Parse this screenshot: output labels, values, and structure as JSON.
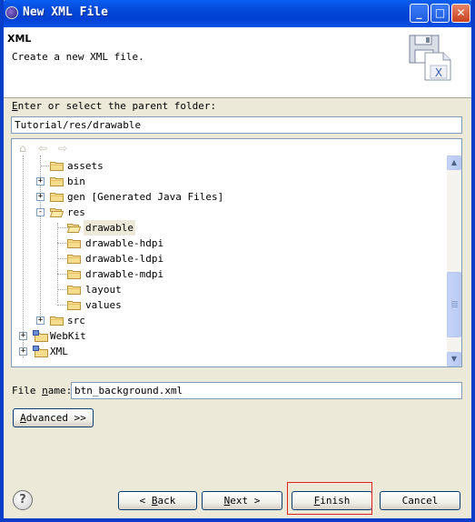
{
  "window": {
    "title": "New XML File",
    "controls": {
      "minimize": "_",
      "maximize": "□",
      "close": "✕"
    }
  },
  "banner": {
    "title": "XML",
    "description": "Create a new XML file."
  },
  "parent_folder": {
    "label_pre": "",
    "label_mnemonic": "E",
    "label_post": "nter or select the parent folder:",
    "value": "Tutorial/res/drawable"
  },
  "tree": {
    "toolbar": [
      "home-icon",
      "back-arrow-icon",
      "forward-arrow-icon"
    ],
    "items": [
      {
        "label": "assets",
        "expander": ""
      },
      {
        "label": "bin",
        "expander": "+"
      },
      {
        "label": "gen [Generated Java Files]",
        "expander": "+"
      },
      {
        "label": "res",
        "expander": "-"
      },
      {
        "label": "drawable",
        "expander": "",
        "selected": true
      },
      {
        "label": "drawable-hdpi",
        "expander": ""
      },
      {
        "label": "drawable-ldpi",
        "expander": ""
      },
      {
        "label": "drawable-mdpi",
        "expander": ""
      },
      {
        "label": "layout",
        "expander": ""
      },
      {
        "label": "values",
        "expander": ""
      },
      {
        "label": "src",
        "expander": "+"
      },
      {
        "label": "WebKit",
        "expander": "+"
      },
      {
        "label": "XML",
        "expander": "+"
      }
    ]
  },
  "file_name": {
    "label_pre": "File ",
    "label_mnemonic": "n",
    "label_post": "ame:",
    "value": "btn_background.xml"
  },
  "buttons": {
    "advanced": {
      "mnemonic": "A",
      "rest": "dvanced >>"
    },
    "back": {
      "pre": "< ",
      "mnemonic": "B",
      "rest": "ack"
    },
    "next": {
      "mnemonic": "N",
      "rest": "ext >"
    },
    "finish": {
      "mnemonic": "F",
      "rest": "inish"
    },
    "cancel": {
      "label": "Cancel"
    },
    "help": {
      "label": "?"
    }
  },
  "colors": {
    "titlebar": "#0247d8",
    "dialog_bg": "#ece9d8",
    "highlight": "#e02020"
  }
}
